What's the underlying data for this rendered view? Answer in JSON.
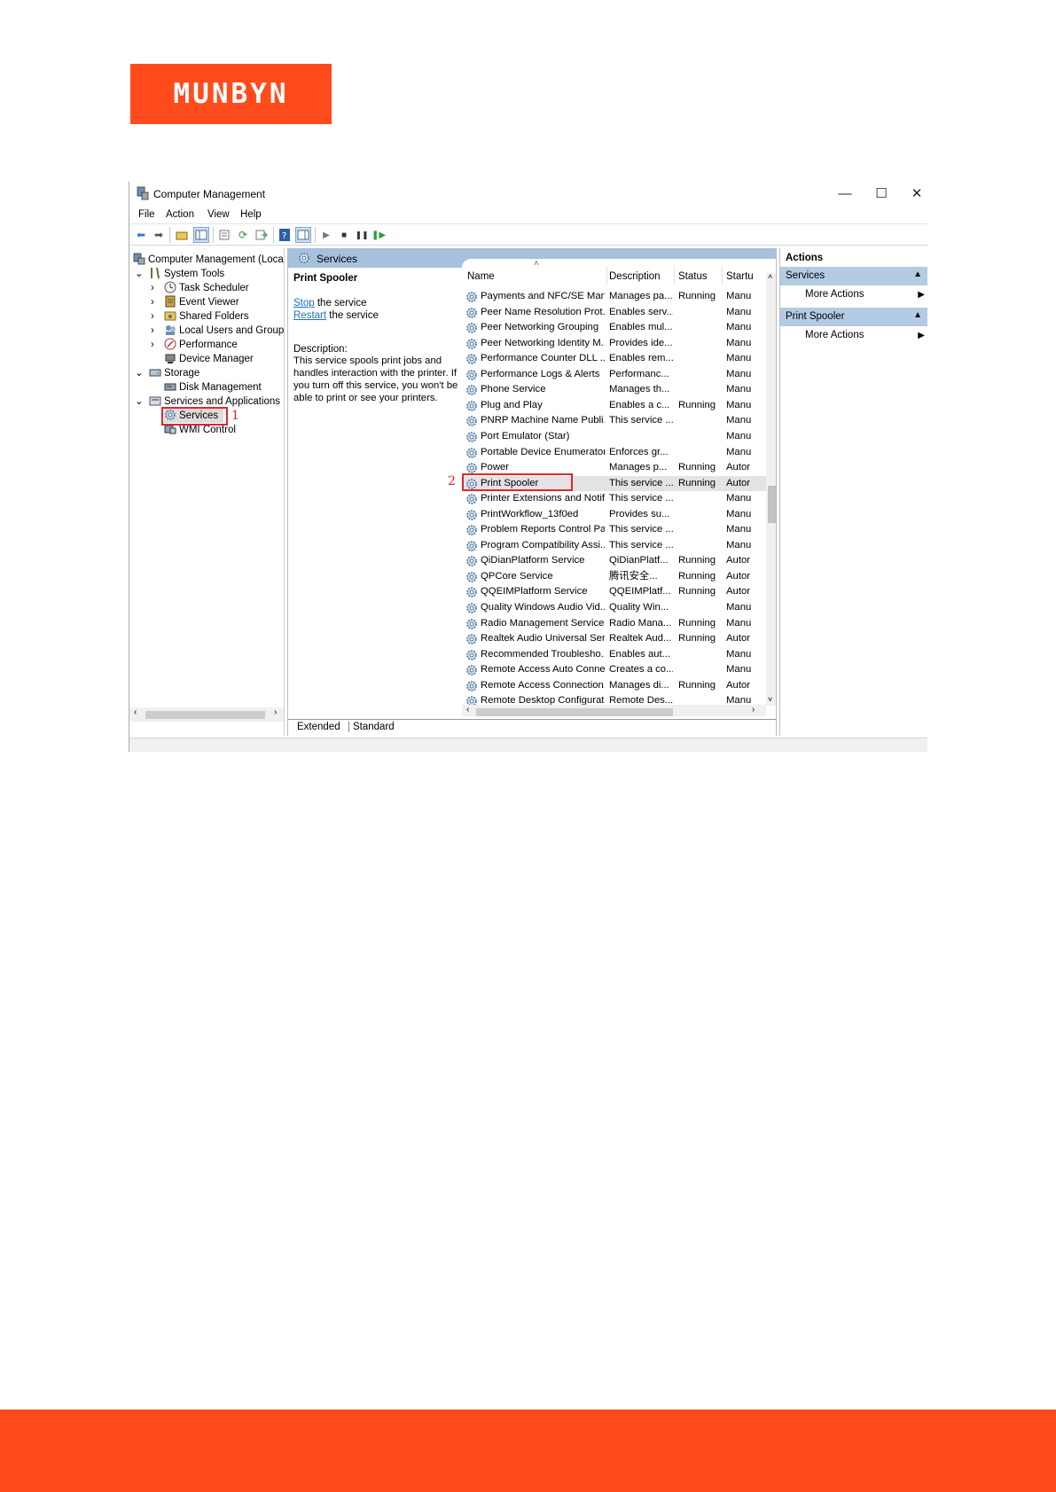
{
  "brand": {
    "logo_text": "MUNBYN",
    "accent_color": "#ff4b1c"
  },
  "window": {
    "title": "Computer Management",
    "controls": [
      "minimize-icon",
      "maximize-icon",
      "close-icon"
    ]
  },
  "menu": [
    "File",
    "Action",
    "View",
    "Help"
  ],
  "toolbar_icons": [
    "back-icon",
    "forward-icon",
    "up-folder-icon",
    "show-hide-tree-icon",
    "properties-icon",
    "refresh-icon",
    "export-icon",
    "help-icon",
    "show-hide-action-pane-icon",
    "play-icon",
    "stop-icon",
    "pause-icon",
    "resume-icon"
  ],
  "tree": {
    "root": "Computer Management (Local",
    "system_tools": "System Tools",
    "task_scheduler": "Task Scheduler",
    "event_viewer": "Event Viewer",
    "shared_folders": "Shared Folders",
    "local_users": "Local Users and Groups",
    "performance": "Performance",
    "device_manager": "Device Manager",
    "storage": "Storage",
    "disk_management": "Disk Management",
    "services_apps": "Services and Applications",
    "services": "Services",
    "wmi": "WMI Control"
  },
  "center": {
    "header": "Services",
    "detail": {
      "title": "Print Spooler",
      "stop_link": "Stop",
      "stop_text": " the service",
      "restart_link": "Restart",
      "restart_text": " the service",
      "description_label": "Description:",
      "description": "This service spools print jobs and handles interaction with the printer. If you turn off this service, you won't be able to print or see your printers."
    },
    "columns": {
      "name": "Name",
      "description": "Description",
      "status": "Status",
      "startup": "Startu"
    },
    "services": [
      {
        "name": "Payments and NFC/SE Man...",
        "description": "Manages pa...",
        "status": "Running",
        "startup": "Manu"
      },
      {
        "name": "Peer Name Resolution Prot...",
        "description": "Enables serv...",
        "status": "",
        "startup": "Manu"
      },
      {
        "name": "Peer Networking Grouping",
        "description": "Enables mul...",
        "status": "",
        "startup": "Manu"
      },
      {
        "name": "Peer Networking Identity M...",
        "description": "Provides ide...",
        "status": "",
        "startup": "Manu"
      },
      {
        "name": "Performance Counter DLL ...",
        "description": "Enables rem...",
        "status": "",
        "startup": "Manu"
      },
      {
        "name": "Performance Logs & Alerts",
        "description": "Performanc...",
        "status": "",
        "startup": "Manu"
      },
      {
        "name": "Phone Service",
        "description": "Manages th...",
        "status": "",
        "startup": "Manu"
      },
      {
        "name": "Plug and Play",
        "description": "Enables a c...",
        "status": "Running",
        "startup": "Manu"
      },
      {
        "name": "PNRP Machine Name Publi...",
        "description": "This service ...",
        "status": "",
        "startup": "Manu"
      },
      {
        "name": "Port Emulator (Star)",
        "description": "",
        "status": "",
        "startup": "Manu"
      },
      {
        "name": "Portable Device Enumerator...",
        "description": "Enforces gr...",
        "status": "",
        "startup": "Manu"
      },
      {
        "name": "Power",
        "description": "Manages p...",
        "status": "Running",
        "startup": "Autor"
      },
      {
        "name": "Print Spooler",
        "description": "This service ...",
        "status": "Running",
        "startup": "Autor"
      },
      {
        "name": "Printer Extensions and Notif...",
        "description": "This service ...",
        "status": "",
        "startup": "Manu"
      },
      {
        "name": "PrintWorkflow_13f0ed",
        "description": "Provides su...",
        "status": "",
        "startup": "Manu"
      },
      {
        "name": "Problem Reports Control Pa...",
        "description": "This service ...",
        "status": "",
        "startup": "Manu"
      },
      {
        "name": "Program Compatibility Assi...",
        "description": "This service ...",
        "status": "",
        "startup": "Manu"
      },
      {
        "name": "QiDianPlatform Service",
        "description": "QiDianPlatf...",
        "status": "Running",
        "startup": "Autor"
      },
      {
        "name": "QPCore Service",
        "description": "腾讯安全...",
        "status": "Running",
        "startup": "Autor"
      },
      {
        "name": "QQEIMPlatform Service",
        "description": "QQEIMPlatf...",
        "status": "Running",
        "startup": "Autor"
      },
      {
        "name": "Quality Windows Audio Vid...",
        "description": "Quality Win...",
        "status": "",
        "startup": "Manu"
      },
      {
        "name": "Radio Management Service",
        "description": "Radio Mana...",
        "status": "Running",
        "startup": "Manu"
      },
      {
        "name": "Realtek Audio Universal Ser...",
        "description": "Realtek Aud...",
        "status": "Running",
        "startup": "Autor"
      },
      {
        "name": "Recommended Troublesho...",
        "description": "Enables aut...",
        "status": "",
        "startup": "Manu"
      },
      {
        "name": "Remote Access Auto Conne...",
        "description": "Creates a co...",
        "status": "",
        "startup": "Manu"
      },
      {
        "name": "Remote Access Connection...",
        "description": "Manages di...",
        "status": "Running",
        "startup": "Autor"
      },
      {
        "name": "Remote Desktop Configurat...",
        "description": "Remote Des...",
        "status": "",
        "startup": "Manu"
      }
    ],
    "selected_index": 12,
    "tabs": [
      "Extended",
      "Standard"
    ]
  },
  "actions": {
    "title": "Actions",
    "section1": "Services",
    "section1_item": "More Actions",
    "section2": "Print Spooler",
    "section2_item": "More Actions"
  },
  "annotations": {
    "step1": "1",
    "step2": "2",
    "color": "#e0272b"
  }
}
